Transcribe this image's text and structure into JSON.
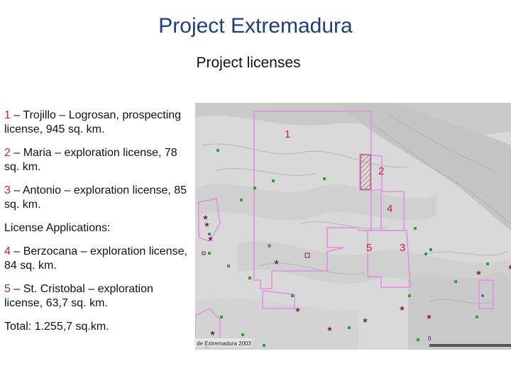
{
  "title": "Project Extremadura",
  "subtitle": "Project licenses",
  "licenses": [
    {
      "num": "1",
      "text": " – Trojillo – Logrosan, prospecting license, 945 sq. km."
    },
    {
      "num": "2",
      "text": " – Maria – exploration license, 78 sq. km."
    },
    {
      "num": "3",
      "text": " – Antonio – exploration license, 85 sq. km."
    }
  ],
  "applications_heading": "License Applications:",
  "applications": [
    {
      "num": "4",
      "text": " – Berzocana – exploration license, 84 sq. km."
    },
    {
      "num": "5",
      "text": " – St. Cristobal – exploration license, 63,7 sq. km."
    }
  ],
  "total": "Total: 1.255,7 sq.km.",
  "map": {
    "labels": {
      "l1": "1",
      "l2": "2",
      "l3": "3",
      "l4": "4",
      "l5": "5"
    },
    "credit": "de Extremadura 2003",
    "scale_zero": "0",
    "colors": {
      "boundary": "#e68be0",
      "label": "#c0282a",
      "marker": "#2fa52f",
      "hatch": "#9c4a5a"
    }
  }
}
